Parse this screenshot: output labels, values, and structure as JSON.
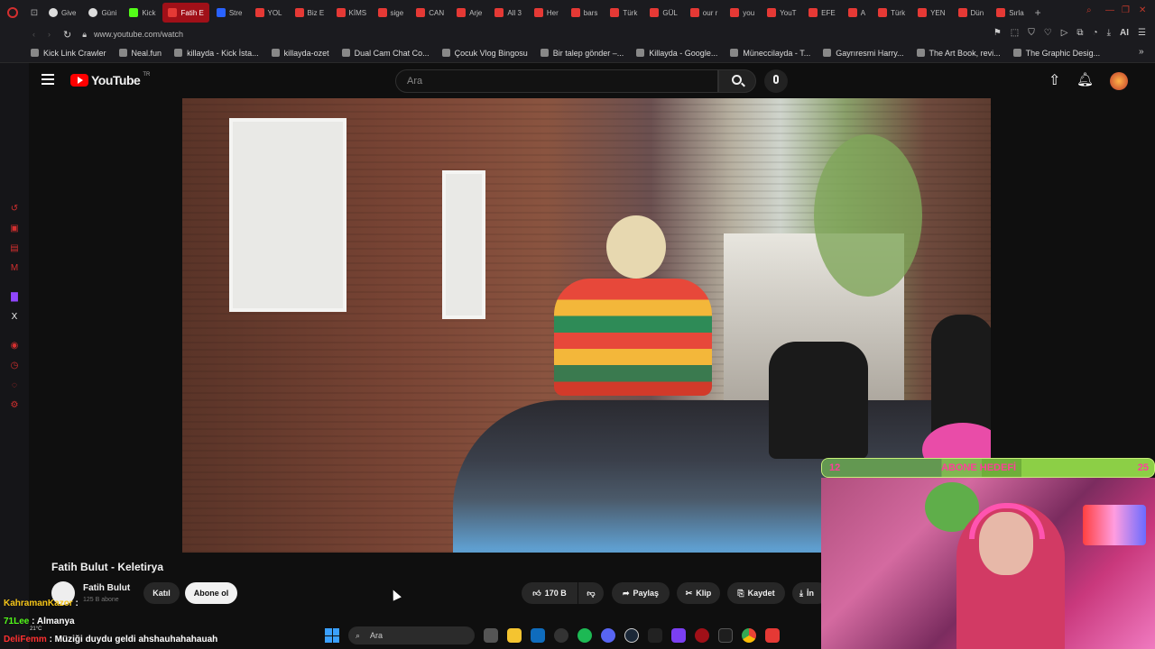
{
  "browser": {
    "tabs": [
      {
        "label": "Give",
        "icon": "github-icon"
      },
      {
        "label": "Güni",
        "icon": "github-icon"
      },
      {
        "label": "Kick",
        "icon": "kick-icon"
      },
      {
        "label": "Fatih E",
        "icon": "youtube-icon",
        "active": true
      },
      {
        "label": "Stre",
        "icon": "streamlabs-icon"
      },
      {
        "label": "YOL",
        "icon": "youtube-icon"
      },
      {
        "label": "Biz E",
        "icon": "youtube-icon"
      },
      {
        "label": "KİMS",
        "icon": "youtube-icon"
      },
      {
        "label": "sige",
        "icon": "youtube-icon"
      },
      {
        "label": "CAN",
        "icon": "youtube-icon"
      },
      {
        "label": "Arje",
        "icon": "youtube-icon"
      },
      {
        "label": "All 3",
        "icon": "youtube-icon"
      },
      {
        "label": "Her",
        "icon": "youtube-icon"
      },
      {
        "label": "bars",
        "icon": "youtube-icon"
      },
      {
        "label": "Türk",
        "icon": "youtube-icon"
      },
      {
        "label": "GÜL",
        "icon": "youtube-icon"
      },
      {
        "label": "our r",
        "icon": "youtube-icon"
      },
      {
        "label": "you",
        "icon": "youtube-icon"
      },
      {
        "label": "YouT",
        "icon": "youtube-icon"
      },
      {
        "label": "EFE",
        "icon": "youtube-icon"
      },
      {
        "label": "A",
        "icon": "youtube-icon"
      },
      {
        "label": "Türk",
        "icon": "youtube-icon"
      },
      {
        "label": "YEN",
        "icon": "youtube-icon"
      },
      {
        "label": "Dün",
        "icon": "youtube-icon"
      },
      {
        "label": "Sırla",
        "icon": "youtube-icon"
      }
    ],
    "url": "www.youtube.com/watch",
    "ai_label": "AI",
    "bookmarks": [
      "Kick Link Crawler",
      "Neal.fun",
      "killayda - Kick İsta...",
      "killayda-ozet",
      "Dual Cam Chat Co...",
      "Çocuk Vlog Bingosu",
      "Bir talep gönder –...",
      "Killayda - Google...",
      "Müneccilayda - T...",
      "Gayrıresmi Harry...",
      "The Art Book, revi...",
      "The Graphic Desig..."
    ]
  },
  "youtube": {
    "logo_text": "YouTube",
    "logo_region": "TR",
    "search_placeholder": "Ara",
    "video_title": "Fatih Bulut - Keletirya",
    "channel_name": "Fatih Bulut",
    "subscribers": "125 B abone",
    "join_label": "Katıl",
    "subscribe_label": "Abone ol",
    "like_count": "170 B",
    "share_label": "Paylaş",
    "clip_label": "Klip",
    "save_label": "Kaydet",
    "download_label": "İn"
  },
  "stream_overlay": {
    "goal_current": "12",
    "goal_title": "ABONE HEDEFİ",
    "goal_target": "25",
    "goal_progress": 0.48,
    "chat": [
      {
        "user": "KahramanKazor",
        "text": ":",
        "color": "#f5c518"
      },
      {
        "user": "71Lee",
        "text": ": Almanya",
        "color": "#53fc18"
      },
      {
        "user": "DeliFemm",
        "text": ": Müziği duydu geldi ahshauhahahauah",
        "color": "#ff3030"
      }
    ],
    "weather": "21°C"
  },
  "taskbar": {
    "search_placeholder": "Ara"
  },
  "colors": {
    "yt_red": "#ff0000",
    "opera_red": "#d32f2f",
    "active_tab": "#a01018"
  }
}
